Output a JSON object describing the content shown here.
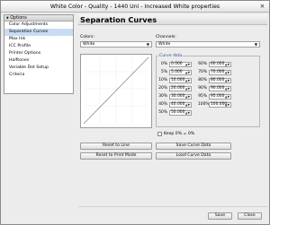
{
  "window": {
    "title": "White Color - Quality - 1440 Uni - Increased White properties",
    "close_glyph": "✕"
  },
  "sidebar": {
    "header": "Options",
    "items": [
      {
        "label": "Color Adjustments",
        "active": false
      },
      {
        "label": "Separation Curves",
        "active": true
      },
      {
        "label": "Max Ink",
        "active": false
      },
      {
        "label": "ICC Profile",
        "active": false
      },
      {
        "label": "Printer Options",
        "active": false
      },
      {
        "label": "Halftones",
        "active": false
      },
      {
        "label": "Variable Dot Setup",
        "active": false
      },
      {
        "label": "Criteria",
        "active": false
      }
    ]
  },
  "main": {
    "title": "Separation Curves",
    "colors_label": "Colors:",
    "colors_value": "White",
    "channels_label": "Channels:",
    "channels_value": "White",
    "curve_data_title": "Curve data",
    "curve_data_left": [
      {
        "pct": "0%",
        "value": "0.000"
      },
      {
        "pct": "5%",
        "value": "5.000"
      },
      {
        "pct": "10%",
        "value": "10.000"
      },
      {
        "pct": "20%",
        "value": "20.000"
      },
      {
        "pct": "30%",
        "value": "30.000"
      },
      {
        "pct": "40%",
        "value": "40.000"
      },
      {
        "pct": "50%",
        "value": "50.000"
      }
    ],
    "curve_data_right": [
      {
        "pct": "60%",
        "value": "60.000"
      },
      {
        "pct": "70%",
        "value": "70.000"
      },
      {
        "pct": "80%",
        "value": "80.000"
      },
      {
        "pct": "90%",
        "value": "90.000"
      },
      {
        "pct": "95%",
        "value": "95.000"
      },
      {
        "pct": "100%",
        "value": "100.000"
      }
    ],
    "keep_label": "Keep 0% = 0%",
    "keep_checked": false,
    "buttons": {
      "reset_line": "Reset to Line",
      "reset_print": "Reset to Print Mode",
      "save_curve": "Save Curve Data",
      "load_curve": "Load Curve Data"
    }
  },
  "footer": {
    "save": "Save",
    "close": "Close"
  },
  "colors": {
    "active_item": "#c8dcf3",
    "curve_line": "#8a8a8a",
    "group_title": "#2a4f9a"
  }
}
